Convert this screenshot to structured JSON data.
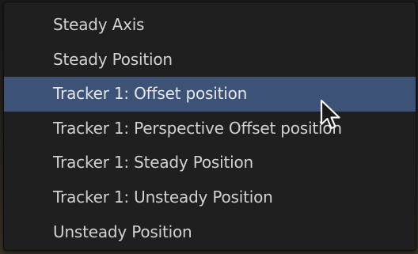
{
  "menu": {
    "items": [
      {
        "label": "Steady Axis"
      },
      {
        "label": "Steady Position"
      },
      {
        "label": "Tracker 1: Offset position"
      },
      {
        "label": "Tracker 1: Perspective Offset position"
      },
      {
        "label": "Tracker 1: Steady Position"
      },
      {
        "label": "Tracker 1: Unsteady Position"
      },
      {
        "label": "Unsteady Position"
      }
    ],
    "highlighted_index": 2,
    "highlight_color": "#3d5277",
    "background_color": "#1f1f1f",
    "text_color": "#d2d2d2"
  },
  "cursor": {
    "icon": "mouse-pointer-icon"
  }
}
